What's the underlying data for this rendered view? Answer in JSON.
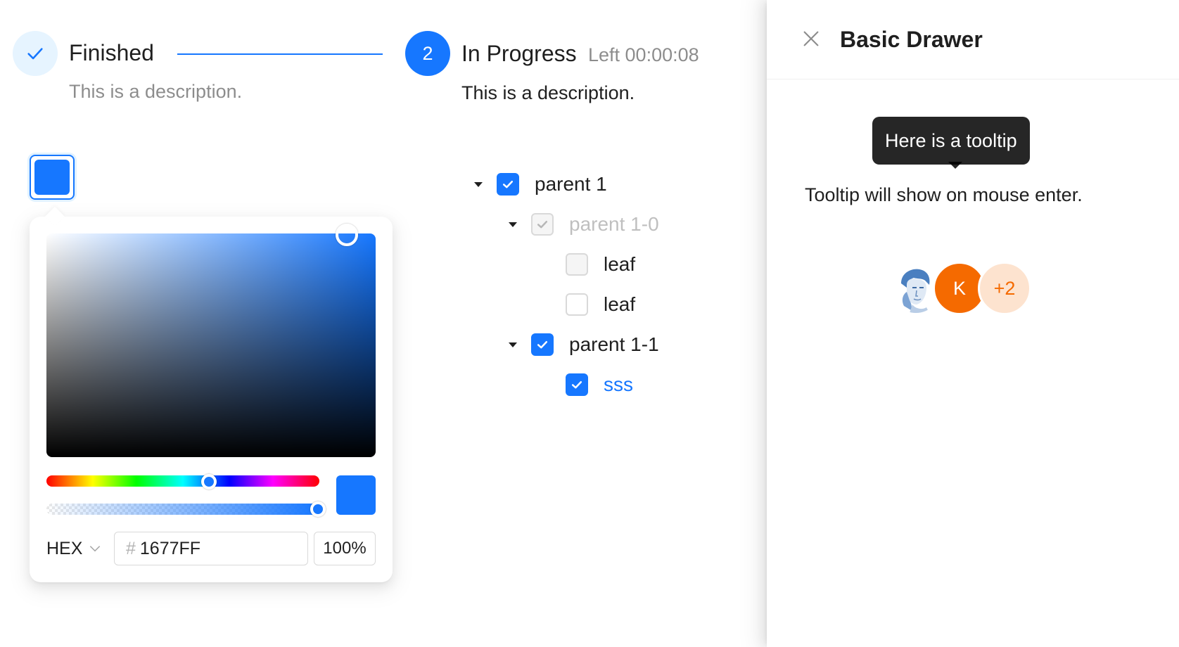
{
  "steps": [
    {
      "title": "Finished",
      "description": "This is a description.",
      "status": "finish",
      "icon": "check-icon"
    },
    {
      "number": "2",
      "title": "In Progress",
      "subtitle": "Left 00:00:08",
      "description": "This is a description.",
      "status": "process"
    }
  ],
  "color_picker": {
    "value_color": "#1677FF",
    "format": "HEX",
    "hex_prefix": "#",
    "hex_value": "1677FF",
    "alpha": "100%"
  },
  "tree": {
    "nodes": [
      {
        "label": "parent 1",
        "state": "checked",
        "expanded": true
      },
      {
        "label": "parent 1-0",
        "state": "disabled-checked",
        "expanded": true
      },
      {
        "label": "leaf",
        "state": "disabled"
      },
      {
        "label": "leaf",
        "state": "unchecked"
      },
      {
        "label": "parent 1-1",
        "state": "checked",
        "expanded": true
      },
      {
        "label": "sss",
        "state": "checked"
      }
    ]
  },
  "drawer": {
    "title": "Basic Drawer",
    "tooltip": "Here is a tooltip",
    "body_text": "Tooltip will show on mouse enter.",
    "avatars": [
      {
        "type": "image",
        "icon": "user-portrait-icon"
      },
      {
        "initial": "K",
        "color": "#f56a00"
      },
      {
        "more": "+2"
      }
    ]
  },
  "colors": {
    "primary": "#1677ff",
    "avatar_orange": "#f56a00",
    "avatar_more_bg": "#fde3cf"
  }
}
